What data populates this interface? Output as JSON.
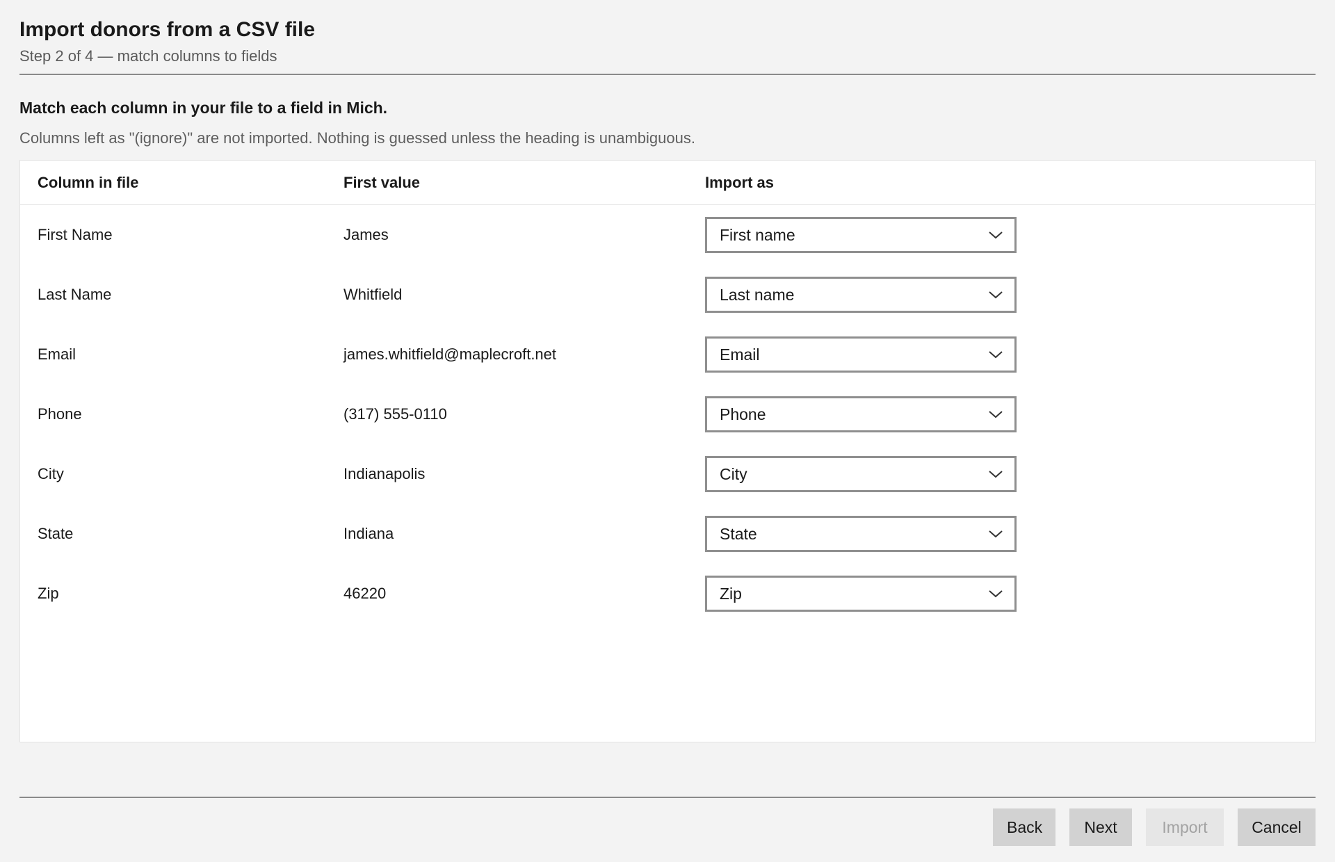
{
  "header": {
    "title": "Import donors from a CSV file",
    "subtitle": "Step 2 of 4 — match columns to fields"
  },
  "instructions": {
    "heading": "Match each column in your file to a field in Mich.",
    "hint": "Columns left as \"(ignore)\" are not imported. Nothing is guessed unless the heading is unambiguous."
  },
  "table": {
    "columns": [
      "Column in file",
      "First value",
      "Import as"
    ],
    "rows": [
      {
        "column": "First Name",
        "value": "James",
        "import_as": "First name"
      },
      {
        "column": "Last Name",
        "value": "Whitfield",
        "import_as": "Last name"
      },
      {
        "column": "Email",
        "value": "james.whitfield@maplecroft.net",
        "import_as": "Email"
      },
      {
        "column": "Phone",
        "value": "(317) 555-0110",
        "import_as": "Phone"
      },
      {
        "column": "City",
        "value": "Indianapolis",
        "import_as": "City"
      },
      {
        "column": "State",
        "value": "Indiana",
        "import_as": "State"
      },
      {
        "column": "Zip",
        "value": "46220",
        "import_as": "Zip"
      }
    ]
  },
  "footer": {
    "back_label": "Back",
    "next_label": "Next",
    "import_label": "Import",
    "cancel_label": "Cancel",
    "import_disabled": true
  },
  "icons": {
    "dropdown": "chevron-down-icon"
  }
}
